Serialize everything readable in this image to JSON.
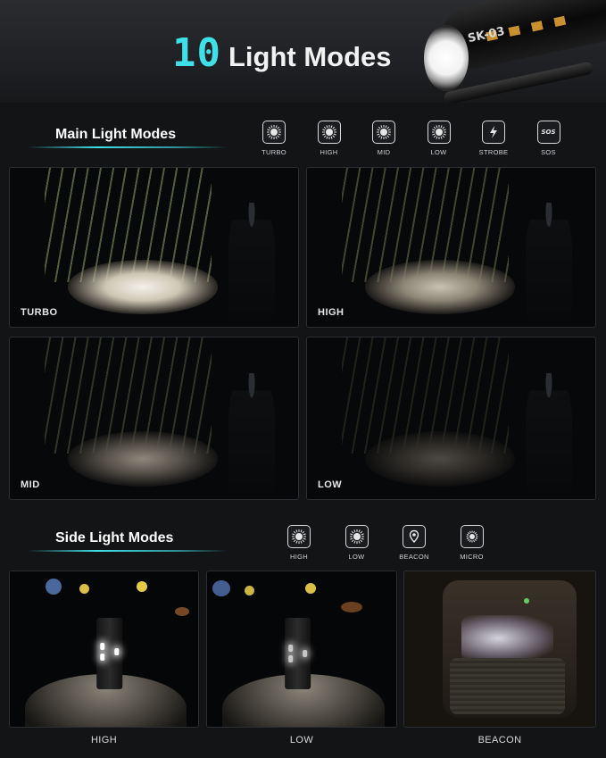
{
  "header": {
    "number": "10",
    "title": "Light Modes",
    "torch_text": "SK-03"
  },
  "main_section": {
    "title": "Main Light Modes",
    "modes": [
      {
        "label": "TURBO",
        "icon": "sun-icon"
      },
      {
        "label": "HIGH",
        "icon": "sun-icon"
      },
      {
        "label": "MID",
        "icon": "sun-icon"
      },
      {
        "label": "LOW",
        "icon": "sun-icon"
      },
      {
        "label": "STROBE",
        "icon": "lightning-icon"
      },
      {
        "label": "SOS",
        "icon": "sos-icon"
      }
    ],
    "photos": [
      {
        "label": "TURBO",
        "brightness": 1.0
      },
      {
        "label": "HIGH",
        "brightness": 0.7
      },
      {
        "label": "MID",
        "brightness": 0.45
      },
      {
        "label": "LOW",
        "brightness": 0.2
      }
    ]
  },
  "side_section": {
    "title": "Side Light Modes",
    "modes": [
      {
        "label": "HIGH",
        "icon": "sun-icon"
      },
      {
        "label": "LOW",
        "icon": "sun-icon"
      },
      {
        "label": "BEACON",
        "icon": "location-pin-icon"
      },
      {
        "label": "MICRO",
        "icon": "small-sun-icon"
      }
    ],
    "photos": [
      {
        "label": "HIGH"
      },
      {
        "label": "LOW"
      },
      {
        "label": "BEACON"
      }
    ]
  },
  "colors": {
    "accent": "#3fe0e8",
    "background": "#121416"
  }
}
